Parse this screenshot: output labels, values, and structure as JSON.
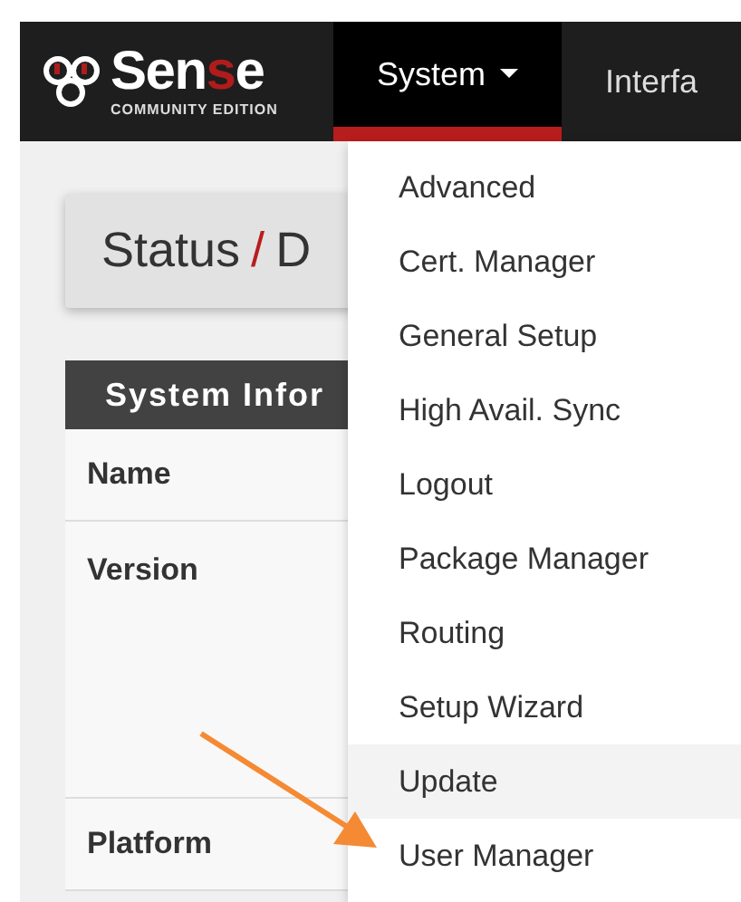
{
  "logo": {
    "wordmark": [
      {
        "text": "Sen",
        "color": "#ffffff"
      },
      {
        "text": "s",
        "color": "#b01c1c"
      },
      {
        "text": "e",
        "color": "#ffffff"
      }
    ],
    "edition": "COMMUNITY EDITION"
  },
  "nav": [
    {
      "label": "System",
      "selected": true,
      "dropdown": true
    },
    {
      "label": "Interfa",
      "selected": false,
      "dropdown": false
    }
  ],
  "breadcrumb": {
    "parts": [
      "Status",
      "D"
    ],
    "separator": "/"
  },
  "panel": {
    "title": "System Infor",
    "rows": [
      {
        "label": "Name",
        "kind": "short"
      },
      {
        "label": "Version",
        "kind": "tall"
      },
      {
        "label": "Platform",
        "kind": "short"
      }
    ]
  },
  "menu": [
    {
      "label": "Advanced",
      "selected": false
    },
    {
      "label": "Cert. Manager",
      "selected": false
    },
    {
      "label": "General Setup",
      "selected": false
    },
    {
      "label": "High Avail. Sync",
      "selected": false
    },
    {
      "label": "Logout",
      "selected": false
    },
    {
      "label": "Package Manager",
      "selected": false
    },
    {
      "label": "Routing",
      "selected": false
    },
    {
      "label": "Setup Wizard",
      "selected": false
    },
    {
      "label": "Update",
      "selected": true
    },
    {
      "label": "User Manager",
      "selected": false
    }
  ]
}
